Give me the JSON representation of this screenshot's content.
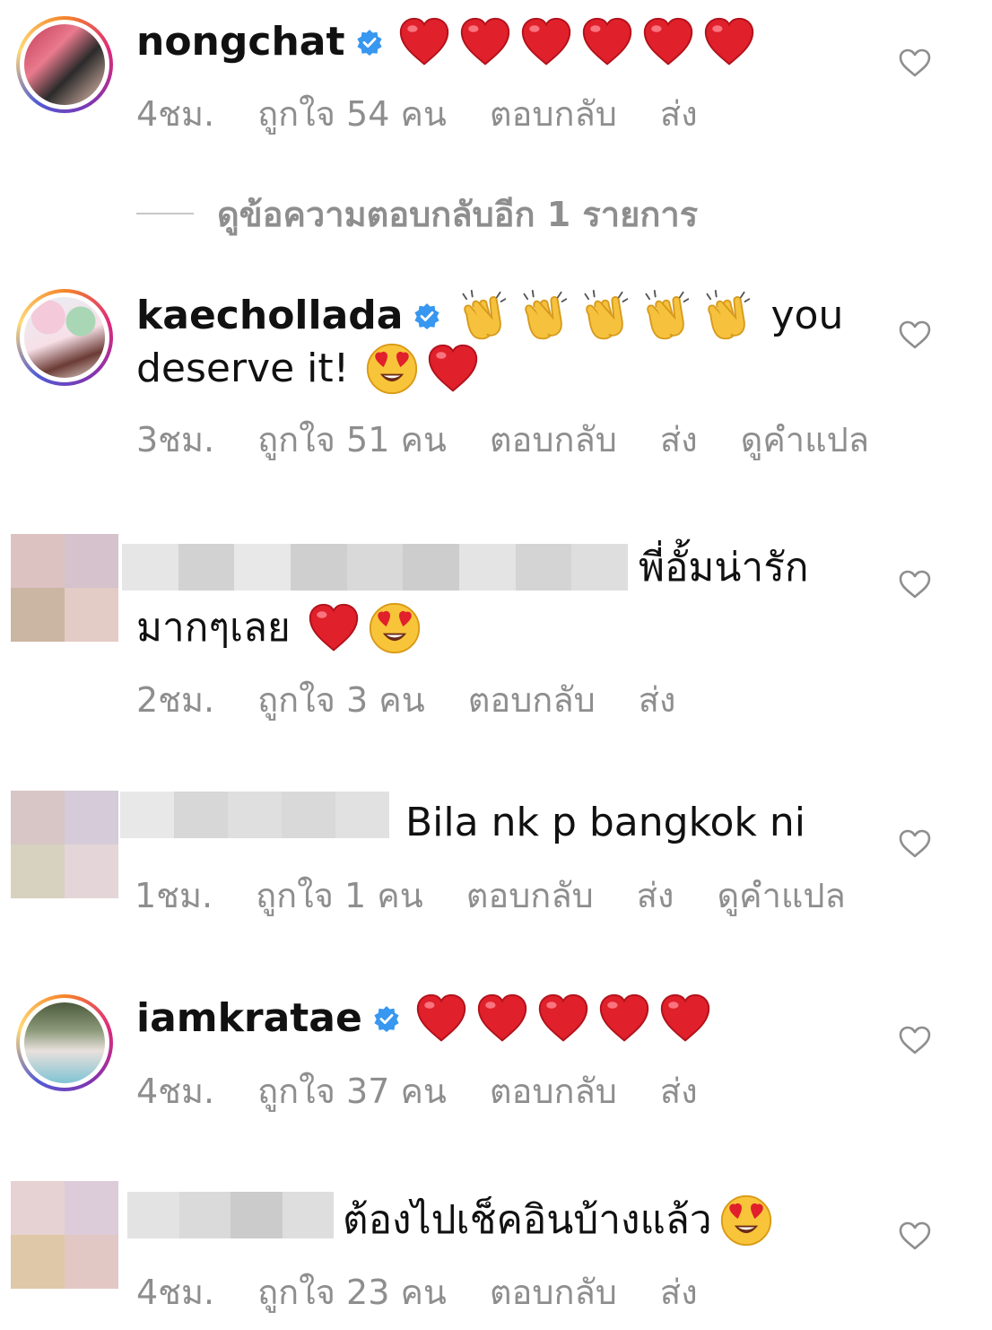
{
  "comments": [
    {
      "username": "nongchat",
      "verified": true,
      "text": "",
      "emoji": [
        "red-heart",
        "red-heart",
        "red-heart",
        "red-heart",
        "red-heart",
        "red-heart"
      ],
      "time": "4ชม.",
      "likes": "ถูกใจ 54 คน",
      "reply": "ตอบกลับ",
      "send": "ส่ง",
      "translate": ""
    },
    {
      "username": "kaechollada",
      "verified": true,
      "text": "you",
      "text2": "deserve it!",
      "emoji": [
        "clapping-hands",
        "clapping-hands",
        "clapping-hands",
        "clapping-hands",
        "clapping-hands"
      ],
      "emoji2": [
        "heart-eyes",
        "red-heart"
      ],
      "time": "3ชม.",
      "likes": "ถูกใจ 51 คน",
      "reply": "ตอบกลับ",
      "send": "ส่ง",
      "translate": "ดูคำแปล"
    },
    {
      "username": "",
      "verified": false,
      "text": "พี่อั้มน่ารัก",
      "text2": "มากๆเลย",
      "emoji2": [
        "red-heart",
        "heart-eyes"
      ],
      "time": "2ชม.",
      "likes": "ถูกใจ 3 คน",
      "reply": "ตอบกลับ",
      "send": "ส่ง",
      "translate": ""
    },
    {
      "username": "",
      "verified": false,
      "text": "Bila nk p bangkok ni",
      "time": "1ชม.",
      "likes": "ถูกใจ 1 คน",
      "reply": "ตอบกลับ",
      "send": "ส่ง",
      "translate": "ดูคำแปล"
    },
    {
      "username": "iamkratae",
      "verified": true,
      "text": "",
      "emoji": [
        "red-heart",
        "red-heart",
        "red-heart",
        "red-heart",
        "red-heart"
      ],
      "time": "4ชม.",
      "likes": "ถูกใจ 37 คน",
      "reply": "ตอบกลับ",
      "send": "ส่ง",
      "translate": ""
    },
    {
      "username": "",
      "verified": false,
      "text": "ต้องไปเช็คอินบ้างแล้ว",
      "emoji_after": [
        "heart-eyes"
      ],
      "time": "4ชม.",
      "likes": "ถูกใจ 23 คน",
      "reply": "ตอบกลับ",
      "send": "ส่ง",
      "translate": ""
    }
  ],
  "view_more_replies": "ดูข้อความตอบกลับอีก 1 รายการ",
  "colors": {
    "meta": "#8e8e8e",
    "verified": "#3897f0",
    "heart": "#e0202b"
  }
}
